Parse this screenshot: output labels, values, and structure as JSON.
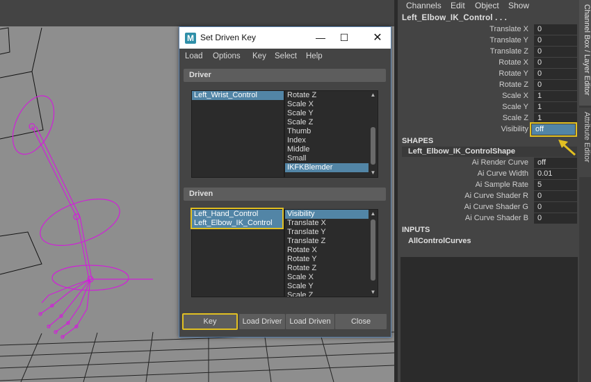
{
  "channel_box": {
    "menu": [
      "Channels",
      "Edit",
      "Object",
      "Show"
    ],
    "object_name": "Left_Elbow_IK_Control . . .",
    "attributes": [
      {
        "label": "Translate X",
        "value": "0"
      },
      {
        "label": "Translate Y",
        "value": "0"
      },
      {
        "label": "Translate Z",
        "value": "0"
      },
      {
        "label": "Rotate X",
        "value": "0"
      },
      {
        "label": "Rotate Y",
        "value": "0"
      },
      {
        "label": "Rotate Z",
        "value": "0"
      },
      {
        "label": "Scale X",
        "value": "1"
      },
      {
        "label": "Scale Y",
        "value": "1"
      },
      {
        "label": "Scale Z",
        "value": "1"
      },
      {
        "label": "Visibility",
        "value": "off"
      }
    ],
    "shapes_header": "SHAPES",
    "shape_name": "Left_Elbow_IK_ControlShape",
    "shape_attributes": [
      {
        "label": "Ai Render Curve",
        "value": "off"
      },
      {
        "label": "Ai Curve Width",
        "value": "0.01"
      },
      {
        "label": "Ai Sample Rate",
        "value": "5"
      },
      {
        "label": "Ai Curve Shader R",
        "value": "0"
      },
      {
        "label": "Ai Curve Shader G",
        "value": "0"
      },
      {
        "label": "Ai Curve Shader B",
        "value": "0"
      }
    ],
    "inputs_header": "INPUTS",
    "input_name": "AllControlCurves"
  },
  "side_tabs": {
    "channel_box_tab": "Channel Box / Layer Editor",
    "attribute_editor_tab": "Attribute Editor"
  },
  "dialog": {
    "icon_letter": "M",
    "title": "Set Driven Key",
    "menu": [
      "Load",
      "Options",
      "Key",
      "Select",
      "Help"
    ],
    "driver_header": "Driver",
    "driver_objects": [
      "Left_Wrist_Control"
    ],
    "driver_attributes": [
      "Rotate Z",
      "Scale X",
      "Scale Y",
      "Scale Z",
      "Thumb",
      "Index",
      "Middle",
      "Small",
      "IKFKBlemder"
    ],
    "driver_selected_attribute": "IKFKBlemder",
    "driven_header": "Driven",
    "driven_objects": [
      "Left_Hand_Control",
      "Left_Elbow_IK_Control"
    ],
    "driven_attributes": [
      "Visibility",
      "Translate X",
      "Translate Y",
      "Translate Z",
      "Rotate X",
      "Rotate Y",
      "Rotate Z",
      "Scale X",
      "Scale Y",
      "Scale Z"
    ],
    "driven_selected_attribute": "Visibility",
    "buttons": {
      "key": "Key",
      "load_driver": "Load Driver",
      "load_driven": "Load Driven",
      "close": "Close"
    }
  },
  "colors": {
    "selection": "#5285a6",
    "highlight": "#e2c022",
    "rig_curves": "#d020d8",
    "panel_bg": "#444444",
    "viewport_bg": "#8e8e8e"
  }
}
